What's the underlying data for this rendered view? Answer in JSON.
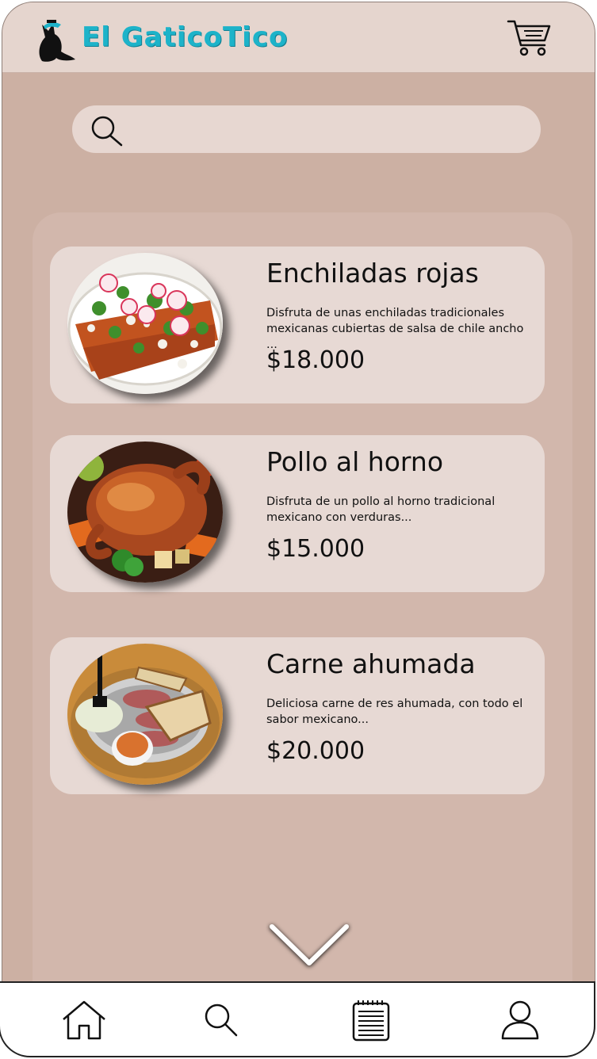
{
  "app": {
    "brand": "El GaticoTico"
  },
  "header": {
    "logo_icon": "cat-logo-icon",
    "cart_icon": "shopping-cart-icon"
  },
  "search": {
    "placeholder": "",
    "value": "",
    "icon": "search-icon"
  },
  "products": [
    {
      "name": "Enchiladas rojas",
      "description": "Disfruta de unas enchiladas tradicionales mexicanas cubiertas de salsa de chile ancho ...",
      "price": "$18.000",
      "image_icon": "enchiladas-photo"
    },
    {
      "name": "Pollo al horno",
      "description": "Disfruta de un pollo al horno tradicional mexicano con verduras...",
      "price": "$15.000",
      "image_icon": "roast-chicken-photo"
    },
    {
      "name": "Carne ahumada",
      "description": "Deliciosa carne de res ahumada, con todo el sabor mexicano...",
      "price": "$20.000",
      "image_icon": "smoked-beef-photo"
    }
  ],
  "scroll": {
    "icon": "chevron-down-icon"
  },
  "bottom_nav": {
    "items": [
      "home-icon",
      "search-icon",
      "menu-list-icon",
      "user-profile-icon"
    ]
  },
  "colors": {
    "background": "#ccb0a3",
    "header": "#e5d5ce",
    "card": "#e7d9d4",
    "brand_accent": "#1db3c9"
  }
}
